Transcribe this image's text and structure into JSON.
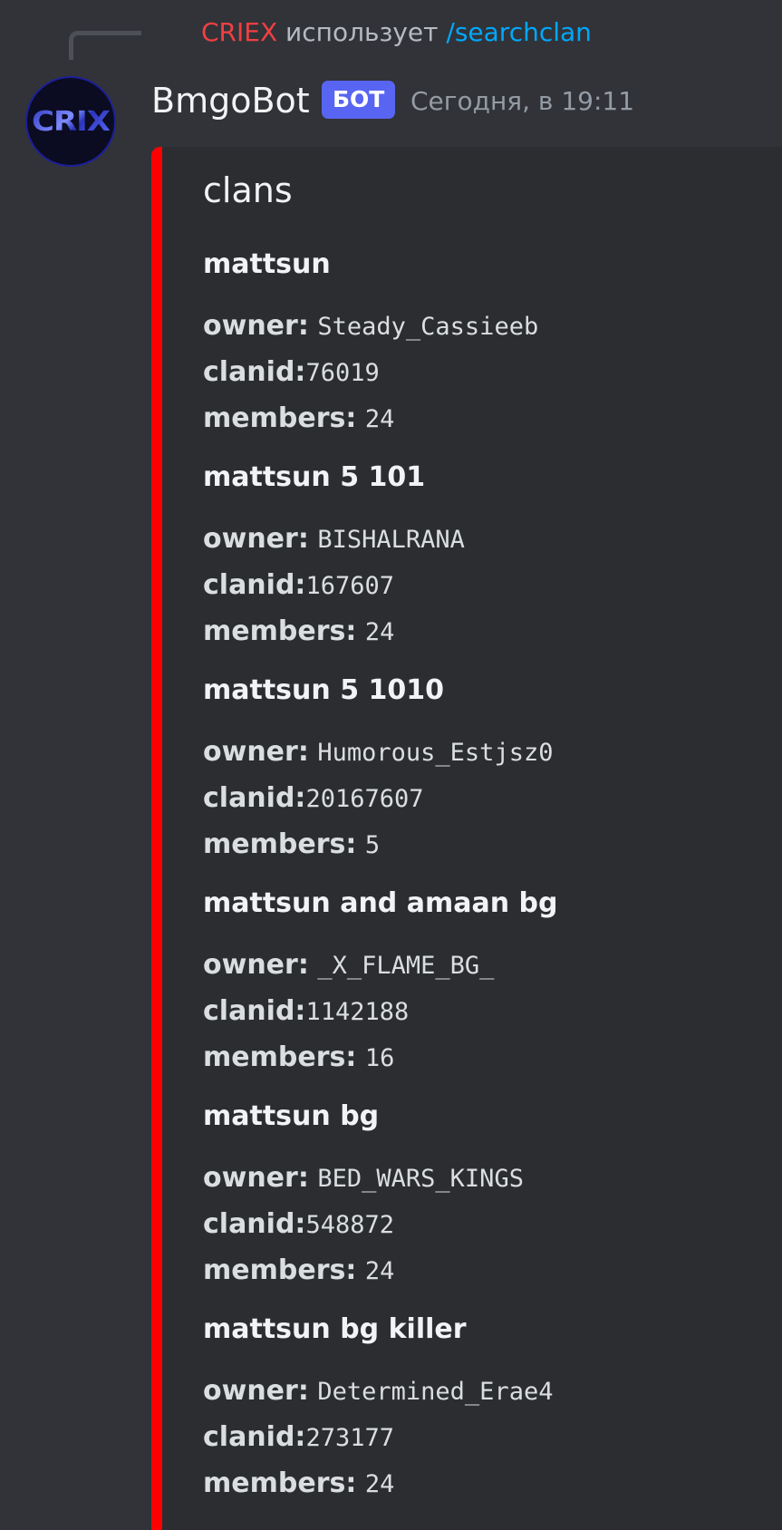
{
  "reply": {
    "user": "CRIEX",
    "uses": "использует",
    "command": "/searchclan"
  },
  "message": {
    "author": "BmgoBot",
    "badge": "БОТ",
    "timestamp": "Сегодня, в 19:11",
    "avatar_text": "CRIX"
  },
  "embed": {
    "accent_color": "#ff0000",
    "title": "clans",
    "labels": {
      "owner": "owner:",
      "clanid": "clanid:",
      "members": "members:"
    },
    "clans": [
      {
        "name": "mattsun",
        "owner": "Steady_Cassieeb",
        "clanid": "76019",
        "members": "24"
      },
      {
        "name": "mattsun 5 101",
        "owner": "BISHALRANA",
        "clanid": "167607",
        "members": "24"
      },
      {
        "name": "mattsun 5 1010",
        "owner": "Humorous_Estjsz0",
        "clanid": "20167607",
        "members": "5"
      },
      {
        "name": "mattsun and amaan bg",
        "owner": "_X_FLAME_BG_",
        "clanid": "1142188",
        "members": "16"
      },
      {
        "name": "mattsun bg",
        "owner": "BED_WARS_KINGS",
        "clanid": "548872",
        "members": "24"
      },
      {
        "name": "mattsun bg killer",
        "owner": "Determined_Erae4",
        "clanid": "273177",
        "members": "24"
      }
    ]
  }
}
